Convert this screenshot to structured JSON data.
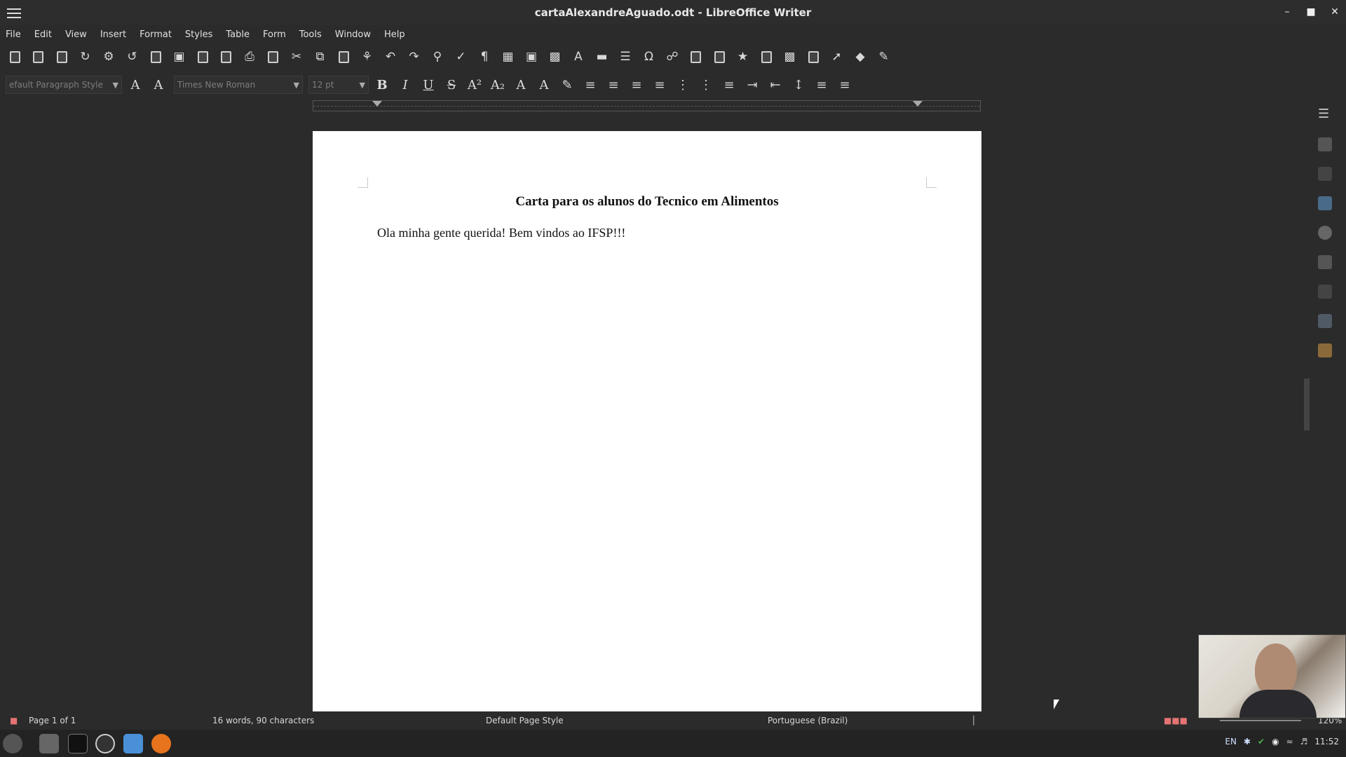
{
  "window": {
    "title": "cartaAlexandreAguado.odt - LibreOffice Writer"
  },
  "menu": {
    "items": [
      "File",
      "Edit",
      "View",
      "Insert",
      "Format",
      "Styles",
      "Table",
      "Form",
      "Tools",
      "Window",
      "Help"
    ]
  },
  "toolbar2": {
    "paragraph_style": "efault Paragraph Style",
    "font_name": "Times New Roman",
    "font_size": "12 pt"
  },
  "document": {
    "title": "Carta para os alunos do Tecnico em Alimentos",
    "body": "Ola minha gente querida! Bem vindos ao IFSP!!!"
  },
  "status": {
    "page": "Page 1 of 1",
    "words": "16 words, 90 characters",
    "page_style": "Default Page Style",
    "language": "Portuguese (Brazil)",
    "zoom": "120%"
  },
  "tray": {
    "lang": "EN",
    "time": "11:52"
  },
  "colors": {
    "accent": "#4a90d9",
    "spell_error": "#e53935"
  }
}
